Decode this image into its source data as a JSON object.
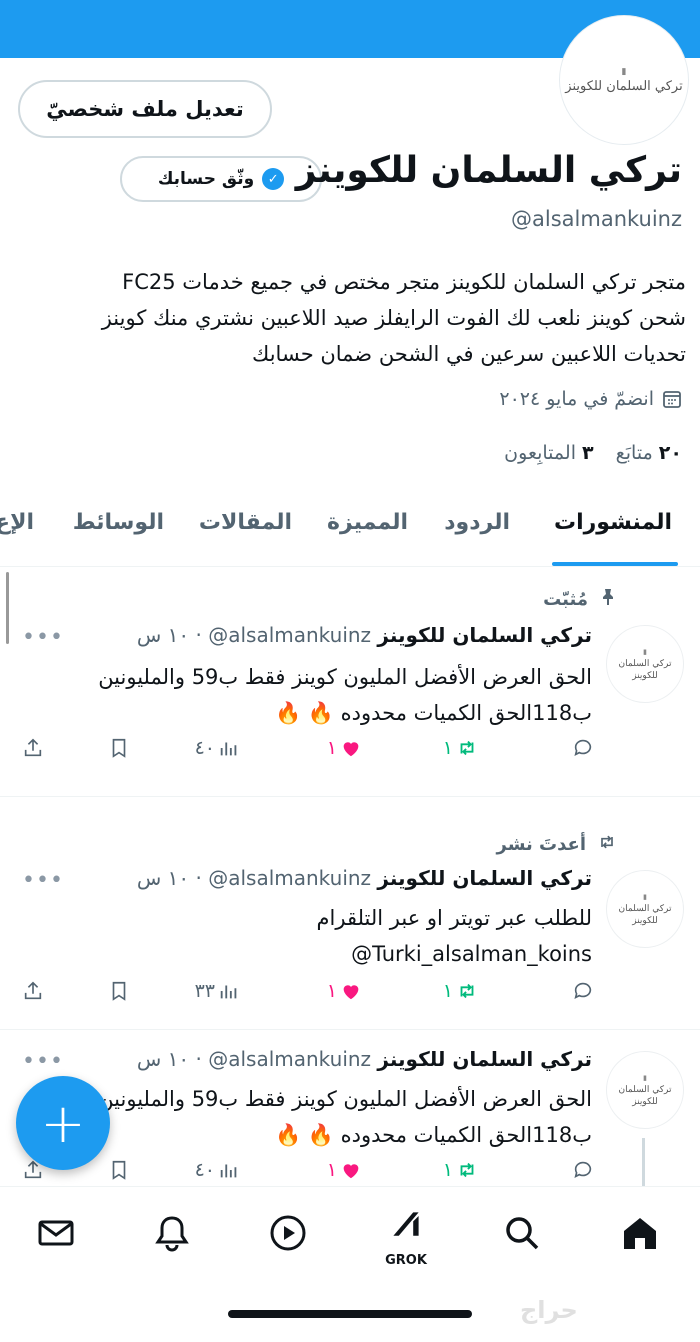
{
  "profile": {
    "edit_button": "تعديل ملف شخصيّ",
    "verify_button": "وثّق حسابك",
    "display_name": "تركي السلمان للكوينز",
    "handle": "@alsalmankuinz",
    "avatar_text": "تركي السلمان للكوينز",
    "bio_lines": [
      "متجر تركي السلمان للكوينز متجر مختص في جميع خدمات FC25",
      "شحن كوينز نلعب لك الفوت الرايفلز صيد اللاعبين نشتري منك كوينز",
      "تحديات اللاعبين سرعين في الشحن ضمان حسابك"
    ],
    "joined": "انضمّ في مايو ٢٠٢٤",
    "following_count": "٢٠",
    "following_label": "متابَع",
    "followers_count": "٣",
    "followers_label": "المتابِعون"
  },
  "tabs": [
    "المنشورات",
    "الردود",
    "المميزة",
    "المقالات",
    "الوسائط",
    "الإع"
  ],
  "posts": [
    {
      "context": "مُثبّت",
      "name": "تركي السلمان للكوينز",
      "handle": "@alsalmankuinz",
      "time": "١٠ س",
      "lines": [
        "الحق العرض الأفضل المليون كوينز فقط ب59 والمليونين",
        "ب118الحق الكميات محدوده 🔥 🔥"
      ],
      "replies": "",
      "reposts": "١",
      "likes": "١",
      "views": "٤٠"
    },
    {
      "context": "أعدتَ نشر",
      "name": "تركي السلمان للكوينز",
      "handle": "@alsalmankuinz",
      "time": "١٠ س",
      "lines": [
        "للطلب عبر تويتر او عبر التلقرام",
        "Turki_alsalman_koins@"
      ],
      "replies": "",
      "reposts": "١",
      "likes": "١",
      "views": "٣٣"
    },
    {
      "context": "",
      "name": "تركي السلمان للكوينز",
      "handle": "@alsalmankuinz",
      "time": "١٠ س",
      "lines": [
        "الحق العرض الأفضل المليون كوينز فقط ب59 والمليونين",
        "ب118الحق الكميات محدوده 🔥 🔥"
      ],
      "replies": "",
      "reposts": "١",
      "likes": "١",
      "views": "٤٠"
    }
  ],
  "nav": {
    "grok_label": "GROK"
  },
  "fab_label": "+",
  "watermark": "حراج",
  "colors": {
    "accent": "#1d9bf0",
    "like": "#f91880",
    "repost": "#00ba7c"
  }
}
